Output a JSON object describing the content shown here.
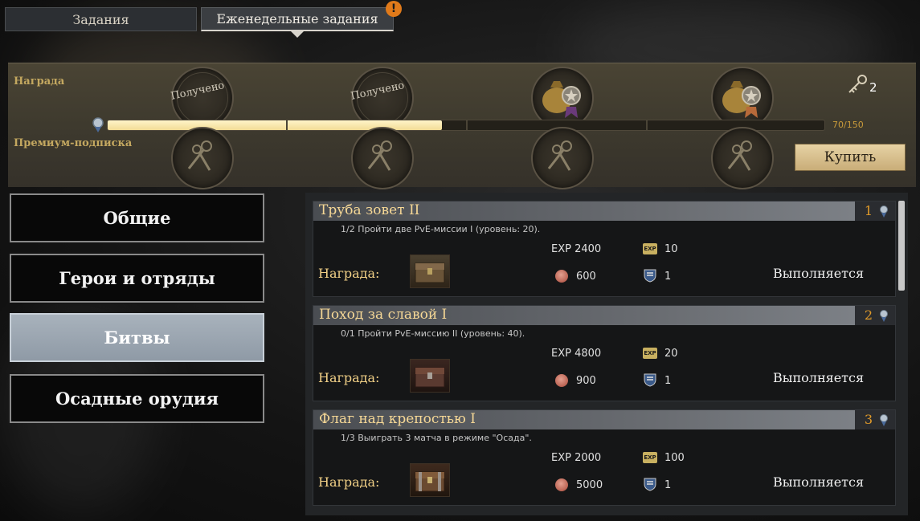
{
  "tabs": {
    "tasks": "Задания",
    "weekly": "Еженедельные задания",
    "alert": "!"
  },
  "reward_panel": {
    "reward_label": "Награда",
    "premium_label": "Премиум-подписка",
    "received_1": "Получено",
    "received_2": "Получено",
    "progress_text": "70/150",
    "progress": {
      "current": 70,
      "max": 150
    },
    "keys_count": "2",
    "buy_button": "Купить"
  },
  "categories": {
    "general": "Общие",
    "heroes": "Герои и отряды",
    "battles": "Битвы",
    "siege": "Осадные орудия"
  },
  "quests": [
    {
      "title": "Труба зовет II",
      "number": "1",
      "description": "1/2  Пройти две PvE-миссии I (уровень: 20).",
      "reward_label": "Награда:",
      "exp": "EXP 2400",
      "coins": "600",
      "exp_bonus": "10",
      "shields": "1",
      "status": "Выполняется"
    },
    {
      "title": "Поход за славой I",
      "number": "2",
      "description": "0/1  Пройти PvE-миссию II (уровень: 40).",
      "reward_label": "Награда:",
      "exp": "EXP 4800",
      "coins": "900",
      "exp_bonus": "20",
      "shields": "1",
      "status": "Выполняется"
    },
    {
      "title": "Флаг над крепостью I",
      "number": "3",
      "description": "1/3  Выиграть 3 матча в режиме \"Осада\".",
      "reward_label": "Награда:",
      "exp": "EXP 2000",
      "coins": "5000",
      "exp_bonus": "100",
      "shields": "1",
      "status": "Выполняется"
    }
  ],
  "icons": {
    "exp_badge": "EXP",
    "coin": "coin-icon",
    "shield": "shield-icon",
    "key": "key-icon",
    "medal": "medal-icon"
  },
  "colors": {
    "gold_text": "#f6d896",
    "orange_number": "#e09a2a",
    "progress_fill": "#f2dc96",
    "active_category": "#9aa4b0"
  }
}
